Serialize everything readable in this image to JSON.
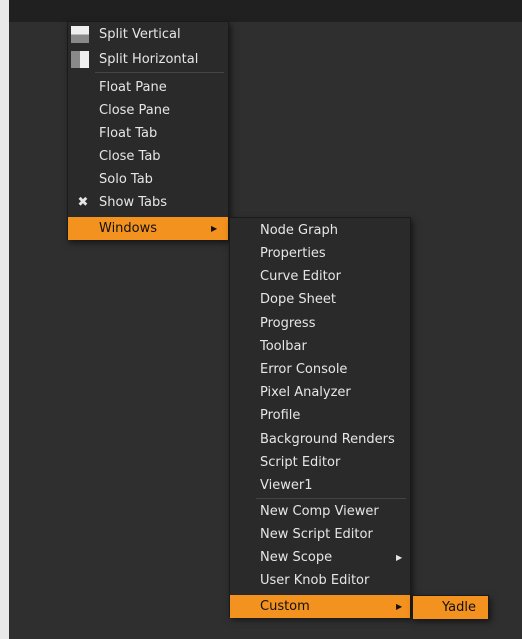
{
  "main_menu": {
    "items": [
      {
        "label": "Split Vertical",
        "icon": "split-vertical-icon"
      },
      {
        "label": "Split Horizontal",
        "icon": "split-horizontal-icon"
      },
      {
        "label": "Float Pane"
      },
      {
        "label": "Close Pane"
      },
      {
        "label": "Float Tab"
      },
      {
        "label": "Close Tab"
      },
      {
        "label": "Solo Tab"
      },
      {
        "label": "Show Tabs",
        "icon": "checkmark-x-icon",
        "checked": true
      },
      {
        "label": "Windows",
        "highlighted": true,
        "submenu": true
      }
    ]
  },
  "windows_menu": {
    "items": [
      {
        "label": "Node Graph"
      },
      {
        "label": "Properties"
      },
      {
        "label": "Curve Editor"
      },
      {
        "label": "Dope Sheet"
      },
      {
        "label": "Progress"
      },
      {
        "label": "Toolbar"
      },
      {
        "label": "Error Console"
      },
      {
        "label": "Pixel Analyzer"
      },
      {
        "label": "Profile"
      },
      {
        "label": "Background Renders"
      },
      {
        "label": "Script Editor"
      },
      {
        "label": "Viewer1"
      },
      {
        "label": "New Comp Viewer"
      },
      {
        "label": "New Script Editor"
      },
      {
        "label": "New Scope",
        "submenu": true
      },
      {
        "label": "User Knob Editor"
      },
      {
        "label": "Custom",
        "highlighted": true,
        "submenu": true
      }
    ]
  },
  "custom_menu": {
    "items": [
      {
        "label": "Yadle",
        "highlighted": true
      }
    ]
  },
  "colors": {
    "highlight": "#f4921f",
    "menu_background": "#2a2a2a",
    "text": "#e6e6e6"
  }
}
